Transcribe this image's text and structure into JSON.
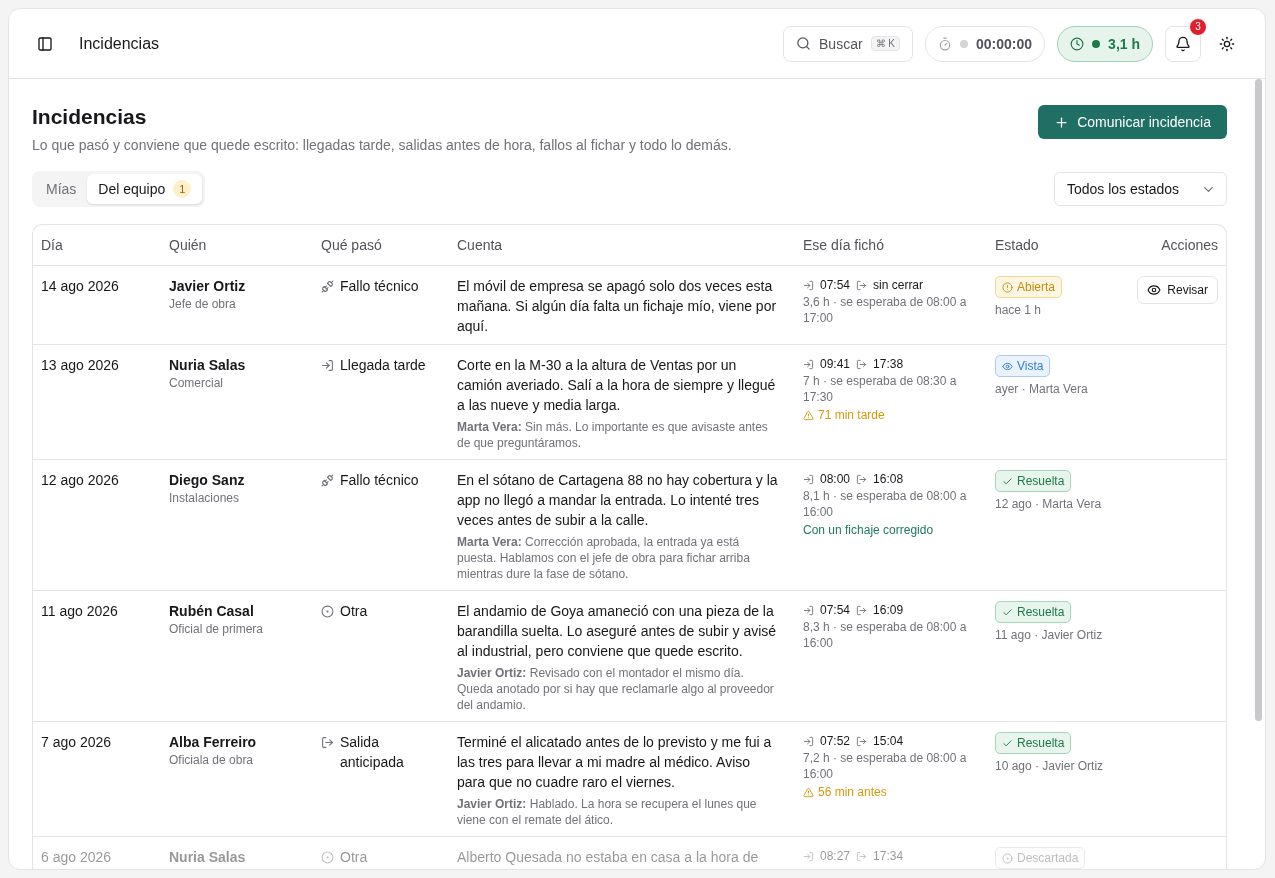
{
  "header": {
    "title": "Incidencias",
    "search": {
      "label": "Buscar",
      "shortcut": "⌘ K"
    },
    "timer": {
      "running": false,
      "value": "00:00:00"
    },
    "worked": {
      "active": true,
      "value": "3,1 h"
    },
    "notifications": {
      "count": "3"
    }
  },
  "page": {
    "title": "Incidencias",
    "subtitle": "Lo que pasó y conviene que quede escrito: llegadas tarde, salidas antes de hora, fallos al fichar y todo lo demás.",
    "primary_button": "Comunicar incidencia"
  },
  "tabs": [
    {
      "label": "Mías",
      "selected": false
    },
    {
      "label": "Del equipo",
      "selected": true,
      "count": "1"
    }
  ],
  "filter": {
    "value": "Todos los estados"
  },
  "table": {
    "columns": [
      "Día",
      "Quién",
      "Qué pasó",
      "Cuenta",
      "Ese día fichó",
      "Estado",
      "Acciones"
    ],
    "rows": [
      {
        "faded": false,
        "day": "14 ago 2026",
        "name": "Javier Ortiz",
        "role": "Jefe de obra",
        "type": {
          "kind": "technical",
          "label": "Fallo técnico"
        },
        "account": "El móvil de empresa se apagó solo dos veces esta mañana. Si algún día falta un fichaje mío, viene por aquí.",
        "clock_in": "07:54",
        "clock_out": "sin cerrar",
        "expected": "3,6 h · se esperaba de 08:00 a 17:00",
        "status": {
          "kind": "open",
          "label": "Abierta"
        },
        "status_meta": "hace 1 h",
        "action": "Revisar"
      },
      {
        "faded": false,
        "day": "13 ago 2026",
        "name": "Nuria Salas",
        "role": "Comercial",
        "type": {
          "kind": "late",
          "label": "Llegada tarde"
        },
        "account": "Corte en la M-30 a la altura de Ventas por un camión averiado. Salí a la hora de siempre y llegué a las nueve y media larga.",
        "reply": "**Marta Vera:** Sin más. Lo importante es que avisaste antes de que preguntáramos.",
        "clock_in": "09:41",
        "clock_out": "17:38",
        "expected": "7 h · se esperaba de 08:30 a 17:30",
        "note": {
          "kind": "warning",
          "text": "71 min tarde"
        },
        "status": {
          "kind": "seen",
          "label": "Vista"
        },
        "status_meta": "ayer · Marta Vera"
      },
      {
        "faded": false,
        "day": "12 ago 2026",
        "name": "Diego Sanz",
        "role": "Instalaciones",
        "type": {
          "kind": "technical",
          "label": "Fallo técnico"
        },
        "account": "En el sótano de Cartagena 88 no hay cobertura y la app no llegó a mandar la entrada. Lo intenté tres veces antes de subir a la calle.",
        "reply": "**Marta Vera:** Corrección aprobada, la entrada ya está puesta. Hablamos con el jefe de obra para fichar arriba mientras dure la fase de sótano.",
        "clock_in": "08:00",
        "clock_out": "16:08",
        "expected": "8,1 h · se esperaba de 08:00 a 16:00",
        "note": {
          "kind": "success",
          "text": "Con un fichaje corregido"
        },
        "status": {
          "kind": "resolved",
          "label": "Resuelta"
        },
        "status_meta": "12 ago · Marta Vera"
      },
      {
        "faded": false,
        "day": "11 ago 2026",
        "name": "Rubén Casal",
        "role": "Oficial de primera",
        "type": {
          "kind": "other",
          "label": "Otra"
        },
        "account": "El andamio de Goya amaneció con una pieza de la barandilla suelta. Lo aseguré antes de subir y avisé al industrial, pero conviene que quede escrito.",
        "reply": "**Javier Ortiz:** Revisado con el montador el mismo día. Queda anotado por si hay que reclamarle algo al proveedor del andamio.",
        "clock_in": "07:54",
        "clock_out": "16:09",
        "expected": "8,3 h · se esperaba de 08:00 a 16:00",
        "status": {
          "kind": "resolved",
          "label": "Resuelta"
        },
        "status_meta": "11 ago · Javier Ortiz"
      },
      {
        "faded": false,
        "day": "7 ago 2026",
        "name": "Alba Ferreiro",
        "role": "Oficiala de obra",
        "type": {
          "kind": "early",
          "label": "Salida anticipada"
        },
        "account": "Terminé el alicatado antes de lo previsto y me fui a las tres para llevar a mi madre al médico. Aviso para que no cuadre raro el viernes.",
        "reply": "**Javier Ortiz:** Hablado. La hora se recupera el lunes que viene con el remate del ático.",
        "clock_in": "07:52",
        "clock_out": "15:04",
        "expected": "7,2 h · se esperaba de 08:00 a 16:00",
        "note": {
          "kind": "warning",
          "text": "56 min antes"
        },
        "status": {
          "kind": "resolved",
          "label": "Resuelta"
        },
        "status_meta": "10 ago · Javier Ortiz"
      },
      {
        "faded": true,
        "day": "6 ago 2026",
        "name": "Nuria Salas",
        "type": {
          "kind": "other",
          "label": "Otra"
        },
        "account": "Alberto Quesada no estaba en casa a la hora de",
        "clock_in": "08:27",
        "clock_out": "17:34",
        "status": {
          "kind": "discarded",
          "label": "Descartada"
        }
      }
    ]
  }
}
